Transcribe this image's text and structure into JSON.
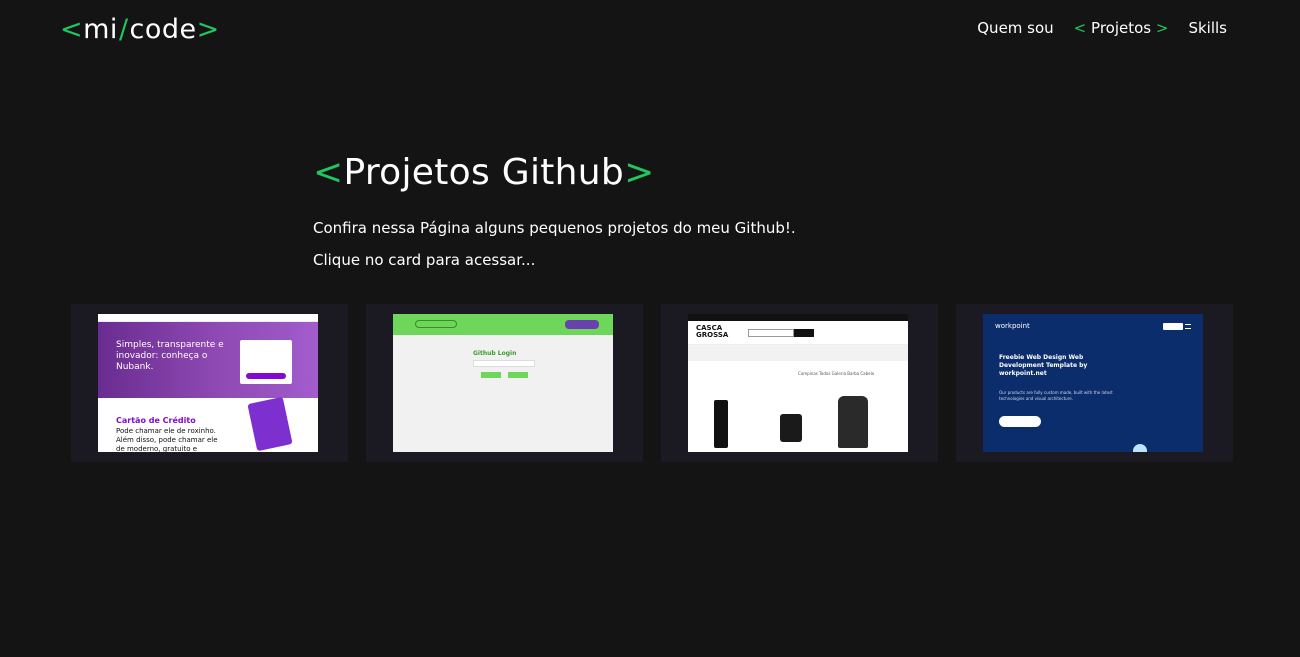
{
  "header": {
    "logo": {
      "open": "<",
      "left": "mi",
      "slash": "/",
      "right": "code",
      "close": ">"
    },
    "nav": [
      {
        "label": "Quem sou",
        "active": false
      },
      {
        "open": "<",
        "label": "Projetos",
        "close": ">",
        "active": true
      },
      {
        "label": "Skills",
        "active": false
      }
    ]
  },
  "intro": {
    "title_open": "<",
    "title": "Projetos Github",
    "title_close": ">",
    "description": "Confira nessa Página alguns pequenos projetos do meu Github!.",
    "call_to_action": "Clique no card para acessar..."
  },
  "colors": {
    "background": "#141414",
    "accent": "#22c55e",
    "card_bg": "#1b1a22"
  },
  "projects": [
    {
      "hero_text": "Simples, transparente e inovador: conheça o Nubank.",
      "section_title": "Cartão de Crédito",
      "section_text": "Pode chamar ele de roxinho. Além disso, pode chamar ele de moderno, gratuito e"
    },
    {
      "heading": "Github Login"
    },
    {
      "brand": "CASCA GROSSA",
      "search_button": "BUSCAR",
      "breadcrumb": "PRODUTOS",
      "filters": "Campinas   Todos   Galeria   Barba   Cabelo"
    },
    {
      "brand": "workpoint",
      "login": "Login",
      "title": "Freebie Web Design Web Development Template by workpoint.net",
      "text": "Our products are fully custom made, built with the latest technologies and visual architecture.",
      "button": "Get Started →"
    }
  ]
}
